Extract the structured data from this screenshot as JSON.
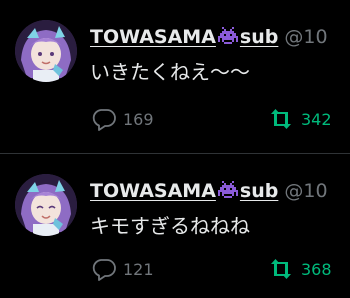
{
  "colors": {
    "background": "#000000",
    "text": "#e7e9ea",
    "muted": "#71767b",
    "retweet_active": "#00ba7c",
    "divider": "#2f3336"
  },
  "tweets": [
    {
      "display_name": "TOWASAMA",
      "name_suffix": "sub",
      "name_icon": "purple-space-invader-icon",
      "handle": "@10",
      "text": "いきたくねえ～～",
      "reply_count": "169",
      "retweet_count": "342"
    },
    {
      "display_name": "TOWASAMA",
      "name_suffix": "sub",
      "name_icon": "purple-space-invader-icon",
      "handle": "@10",
      "text": "キモすぎるねねね",
      "reply_count": "121",
      "retweet_count": "368"
    }
  ]
}
